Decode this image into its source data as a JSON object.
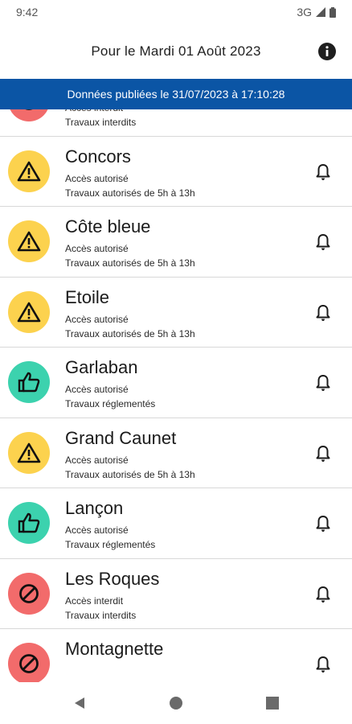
{
  "status_bar": {
    "time": "9:42",
    "network": "3G"
  },
  "header": {
    "title": "Pour le Mardi 01 Août 2023",
    "info_icon": "info-icon"
  },
  "banner": {
    "text": "Données publiées le 31/07/2023 à 17:10:28"
  },
  "colors": {
    "forbidden": "#f26b6b",
    "warning": "#fcd24e",
    "allowed": "#3cd2ae",
    "banner": "#0b55a5"
  },
  "massifs": [
    {
      "name": "",
      "status": "forbidden",
      "access": "Accès interdit",
      "works": "Travaux interdits"
    },
    {
      "name": "Concors",
      "status": "warning",
      "access": "Accès autorisé",
      "works": "Travaux autorisés de 5h à 13h"
    },
    {
      "name": "Côte bleue",
      "status": "warning",
      "access": "Accès autorisé",
      "works": "Travaux autorisés de 5h à 13h"
    },
    {
      "name": "Etoile",
      "status": "warning",
      "access": "Accès autorisé",
      "works": "Travaux autorisés de 5h à 13h"
    },
    {
      "name": "Garlaban",
      "status": "allowed",
      "access": "Accès autorisé",
      "works": "Travaux réglementés"
    },
    {
      "name": "Grand Caunet",
      "status": "warning",
      "access": "Accès autorisé",
      "works": "Travaux autorisés de 5h à 13h"
    },
    {
      "name": "Lançon",
      "status": "allowed",
      "access": "Accès autorisé",
      "works": "Travaux réglementés"
    },
    {
      "name": "Les Roques",
      "status": "forbidden",
      "access": "Accès interdit",
      "works": "Travaux interdits"
    },
    {
      "name": "Montagnette",
      "status": "forbidden",
      "access": "",
      "works": ""
    }
  ]
}
